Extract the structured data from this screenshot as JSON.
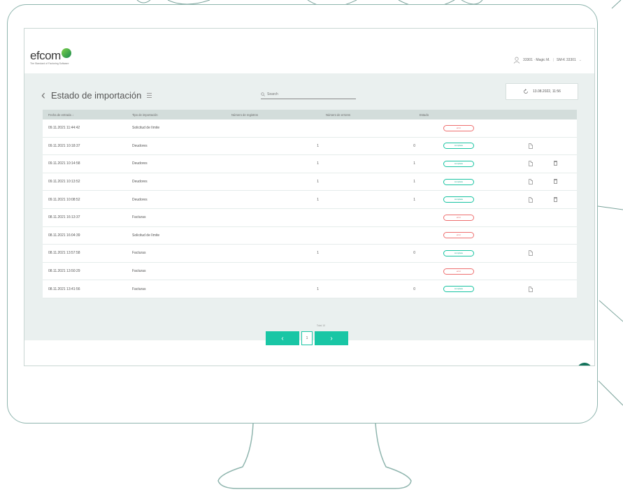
{
  "app": {
    "logo_text": "efcom",
    "logo_tagline": "The Standard of Factoring Software",
    "user_label": "33301 · Magic M.",
    "user_scope": "SM-K 33301"
  },
  "page": {
    "title": "Estado de importación",
    "search_placeholder": "Search",
    "refresh_label": "13.08.2022, 11:56"
  },
  "table": {
    "headers": [
      "Fecha de entrada ↓",
      "Tipo de importación",
      "Número de registros",
      "Número de errores",
      "Estado",
      ""
    ],
    "rows": [
      {
        "date": "09.11.2021 11:44:42",
        "type": "Solicitud de límite",
        "records": "",
        "errors": "",
        "status": "error",
        "status_kind": "err",
        "doc": false,
        "del": false
      },
      {
        "date": "09.11.2021 10:18:37",
        "type": "Deudores",
        "records": "1",
        "errors": "0",
        "status": "complete",
        "status_kind": "ok",
        "doc": true,
        "del": false
      },
      {
        "date": "09.11.2021 10:14:58",
        "type": "Deudores",
        "records": "1",
        "errors": "1",
        "status": "complete",
        "status_kind": "ok",
        "doc": true,
        "del": true
      },
      {
        "date": "09.11.2021 10:13:52",
        "type": "Deudores",
        "records": "1",
        "errors": "1",
        "status": "complete",
        "status_kind": "ok",
        "doc": true,
        "del": true
      },
      {
        "date": "09.11.2021 10:08:52",
        "type": "Deudores",
        "records": "1",
        "errors": "1",
        "status": "complete",
        "status_kind": "ok",
        "doc": true,
        "del": true
      },
      {
        "date": "08.11.2021 16:13:37",
        "type": "Facturas",
        "records": "",
        "errors": "",
        "status": "error",
        "status_kind": "err",
        "doc": false,
        "del": false
      },
      {
        "date": "08.11.2021 16:04:39",
        "type": "Solicitud de límite",
        "records": "",
        "errors": "",
        "status": "error",
        "status_kind": "err",
        "doc": false,
        "del": false
      },
      {
        "date": "08.11.2021 13:57:58",
        "type": "Facturas",
        "records": "1",
        "errors": "0",
        "status": "complete",
        "status_kind": "ok",
        "doc": true,
        "del": false
      },
      {
        "date": "08.11.2021 13:50:29",
        "type": "Facturas",
        "records": "",
        "errors": "",
        "status": "error",
        "status_kind": "err",
        "doc": false,
        "del": false
      },
      {
        "date": "08.11.2021 13:41:56",
        "type": "Facturas",
        "records": "1",
        "errors": "0",
        "status": "complete",
        "status_kind": "ok",
        "doc": true,
        "del": false
      }
    ]
  },
  "pagination": {
    "info": "Total 10",
    "prev": "‹",
    "current": "1",
    "next": "›"
  },
  "colors": {
    "accent": "#19c6a5",
    "error": "#ee6f6f",
    "bell": "#12725a",
    "monitor_outline": "#8fb5ae"
  }
}
